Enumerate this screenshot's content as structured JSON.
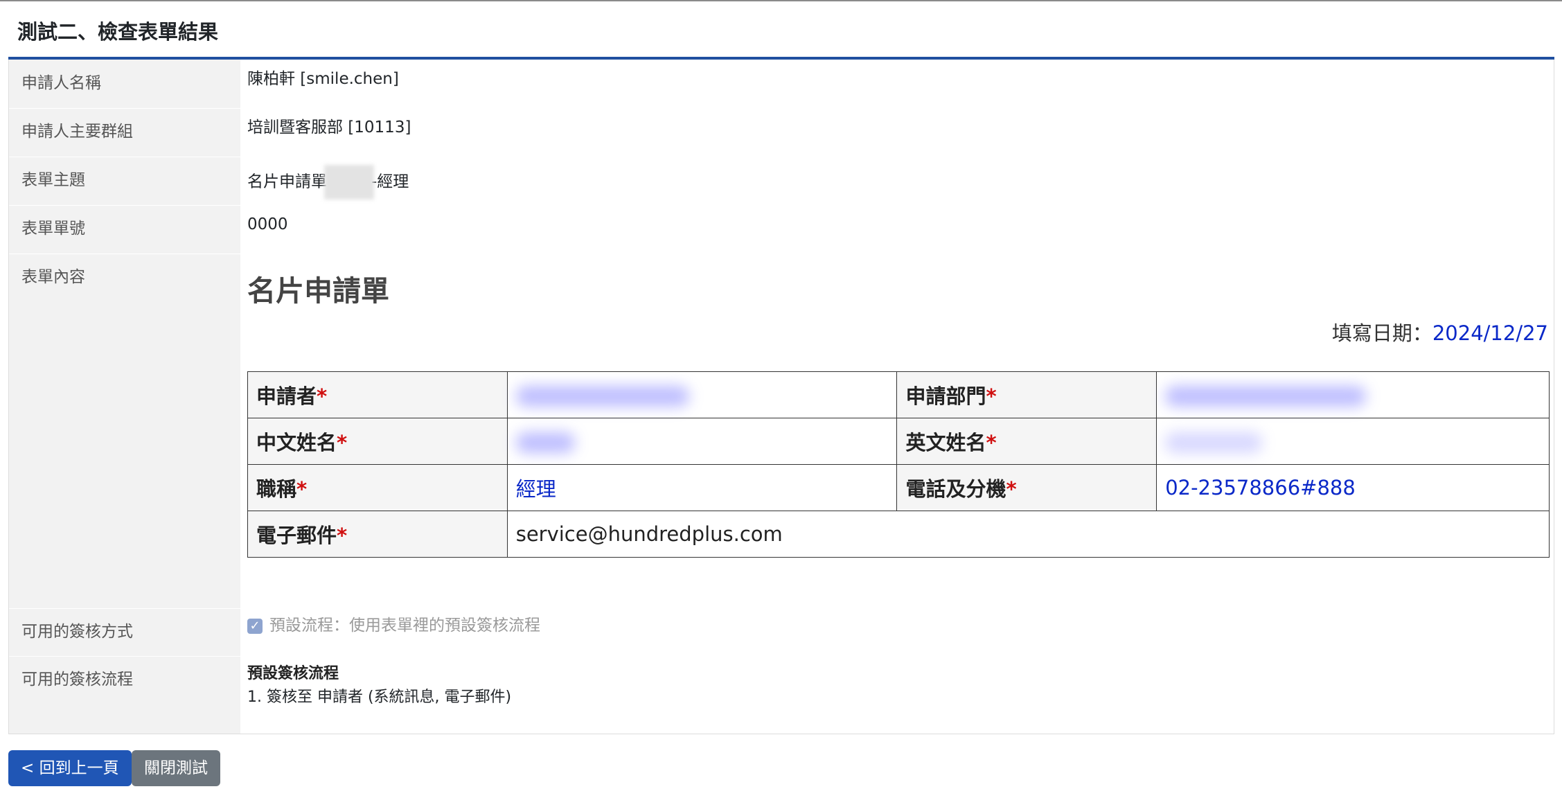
{
  "page_title": "測試二、檢查表單結果",
  "rows": {
    "applicant_name_label": "申請人名稱",
    "applicant_name_value": "陳柏軒 [smile.chen]",
    "applicant_group_label": "申請人主要群組",
    "applicant_group_value": "培訓暨客服部 [10113]",
    "subject_label": "表單主題",
    "subject_prefix": "名片申請單",
    "subject_suffix": "-經理",
    "form_no_label": "表單單號",
    "form_no_value": "0000",
    "content_label": "表單內容",
    "sign_method_label": "可用的簽核方式",
    "sign_flow_label": "可用的簽核流程"
  },
  "form": {
    "title": "名片申請單",
    "fill_date_label": "填寫日期：",
    "fill_date_value": "2024/12/27",
    "required_mark": "*",
    "applicant_label": "申請者",
    "department_label": "申請部門",
    "chinese_name_label": "中文姓名",
    "english_name_label": "英文姓名",
    "title_label": "職稱",
    "title_value": "經理",
    "phone_label": "電話及分機",
    "phone_value": "02-23578866#888",
    "email_label": "電子郵件",
    "email_value": "service@hundredplus.com"
  },
  "sign_method": {
    "checkbox_label": "預設流程：使用表單裡的預設簽核流程",
    "checked": true
  },
  "sign_flow": {
    "title": "預設簽核流程",
    "step": "1. 簽核至 申請者 (系統訊息, 電子郵件)"
  },
  "buttons": {
    "back": "< 回到上一頁",
    "close": "關閉測試"
  },
  "colors": {
    "accent_blue": "#2050a0",
    "value_blue": "#0a28c8",
    "required_red": "#d01010",
    "back_button": "#2056b5",
    "close_button": "#6c757d"
  }
}
